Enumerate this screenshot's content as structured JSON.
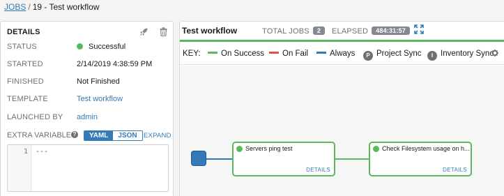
{
  "breadcrumb": {
    "jobs": "JOBS",
    "separator": "/",
    "current": "19 - Test workflow"
  },
  "details": {
    "title": "DETAILS",
    "rows": {
      "status": {
        "label": "STATUS",
        "value": "Successful"
      },
      "started": {
        "label": "STARTED",
        "value": "2/14/2019 4:38:59 PM"
      },
      "finished": {
        "label": "FINISHED",
        "value": "Not Finished"
      },
      "template": {
        "label": "TEMPLATE",
        "value": "Test workflow"
      },
      "launched_by": {
        "label": "LAUNCHED BY",
        "value": "admin"
      }
    },
    "extra_variables": {
      "label": "EXTRA VARIABLES",
      "help": "?",
      "yaml": "YAML",
      "json": "JSON",
      "expand": "EXPAND",
      "line_number": "1",
      "code": "---"
    },
    "icons": [
      "relaunch-icon",
      "delete-icon"
    ]
  },
  "workflow": {
    "title": "Test workflow",
    "total_jobs_label": "TOTAL JOBS",
    "total_jobs": "2",
    "elapsed_label": "ELAPSED",
    "elapsed": "484:31:57",
    "key": {
      "label": "KEY:",
      "on_success": "On Success",
      "on_fail": "On Fail",
      "always": "Always",
      "project_sync": "Project Sync",
      "project_letter": "P",
      "inventory_sync": "Inventory Sync",
      "inventory_letter": "I"
    },
    "nodes": [
      {
        "name": "Servers ping test",
        "details": "DETAILS"
      },
      {
        "name": "Check Filesystem usage on h...",
        "details": "DETAILS"
      }
    ]
  },
  "colors": {
    "success": "#5cb85c",
    "fail": "#d9534f",
    "always": "#337ab7",
    "link": "#337ab7"
  }
}
